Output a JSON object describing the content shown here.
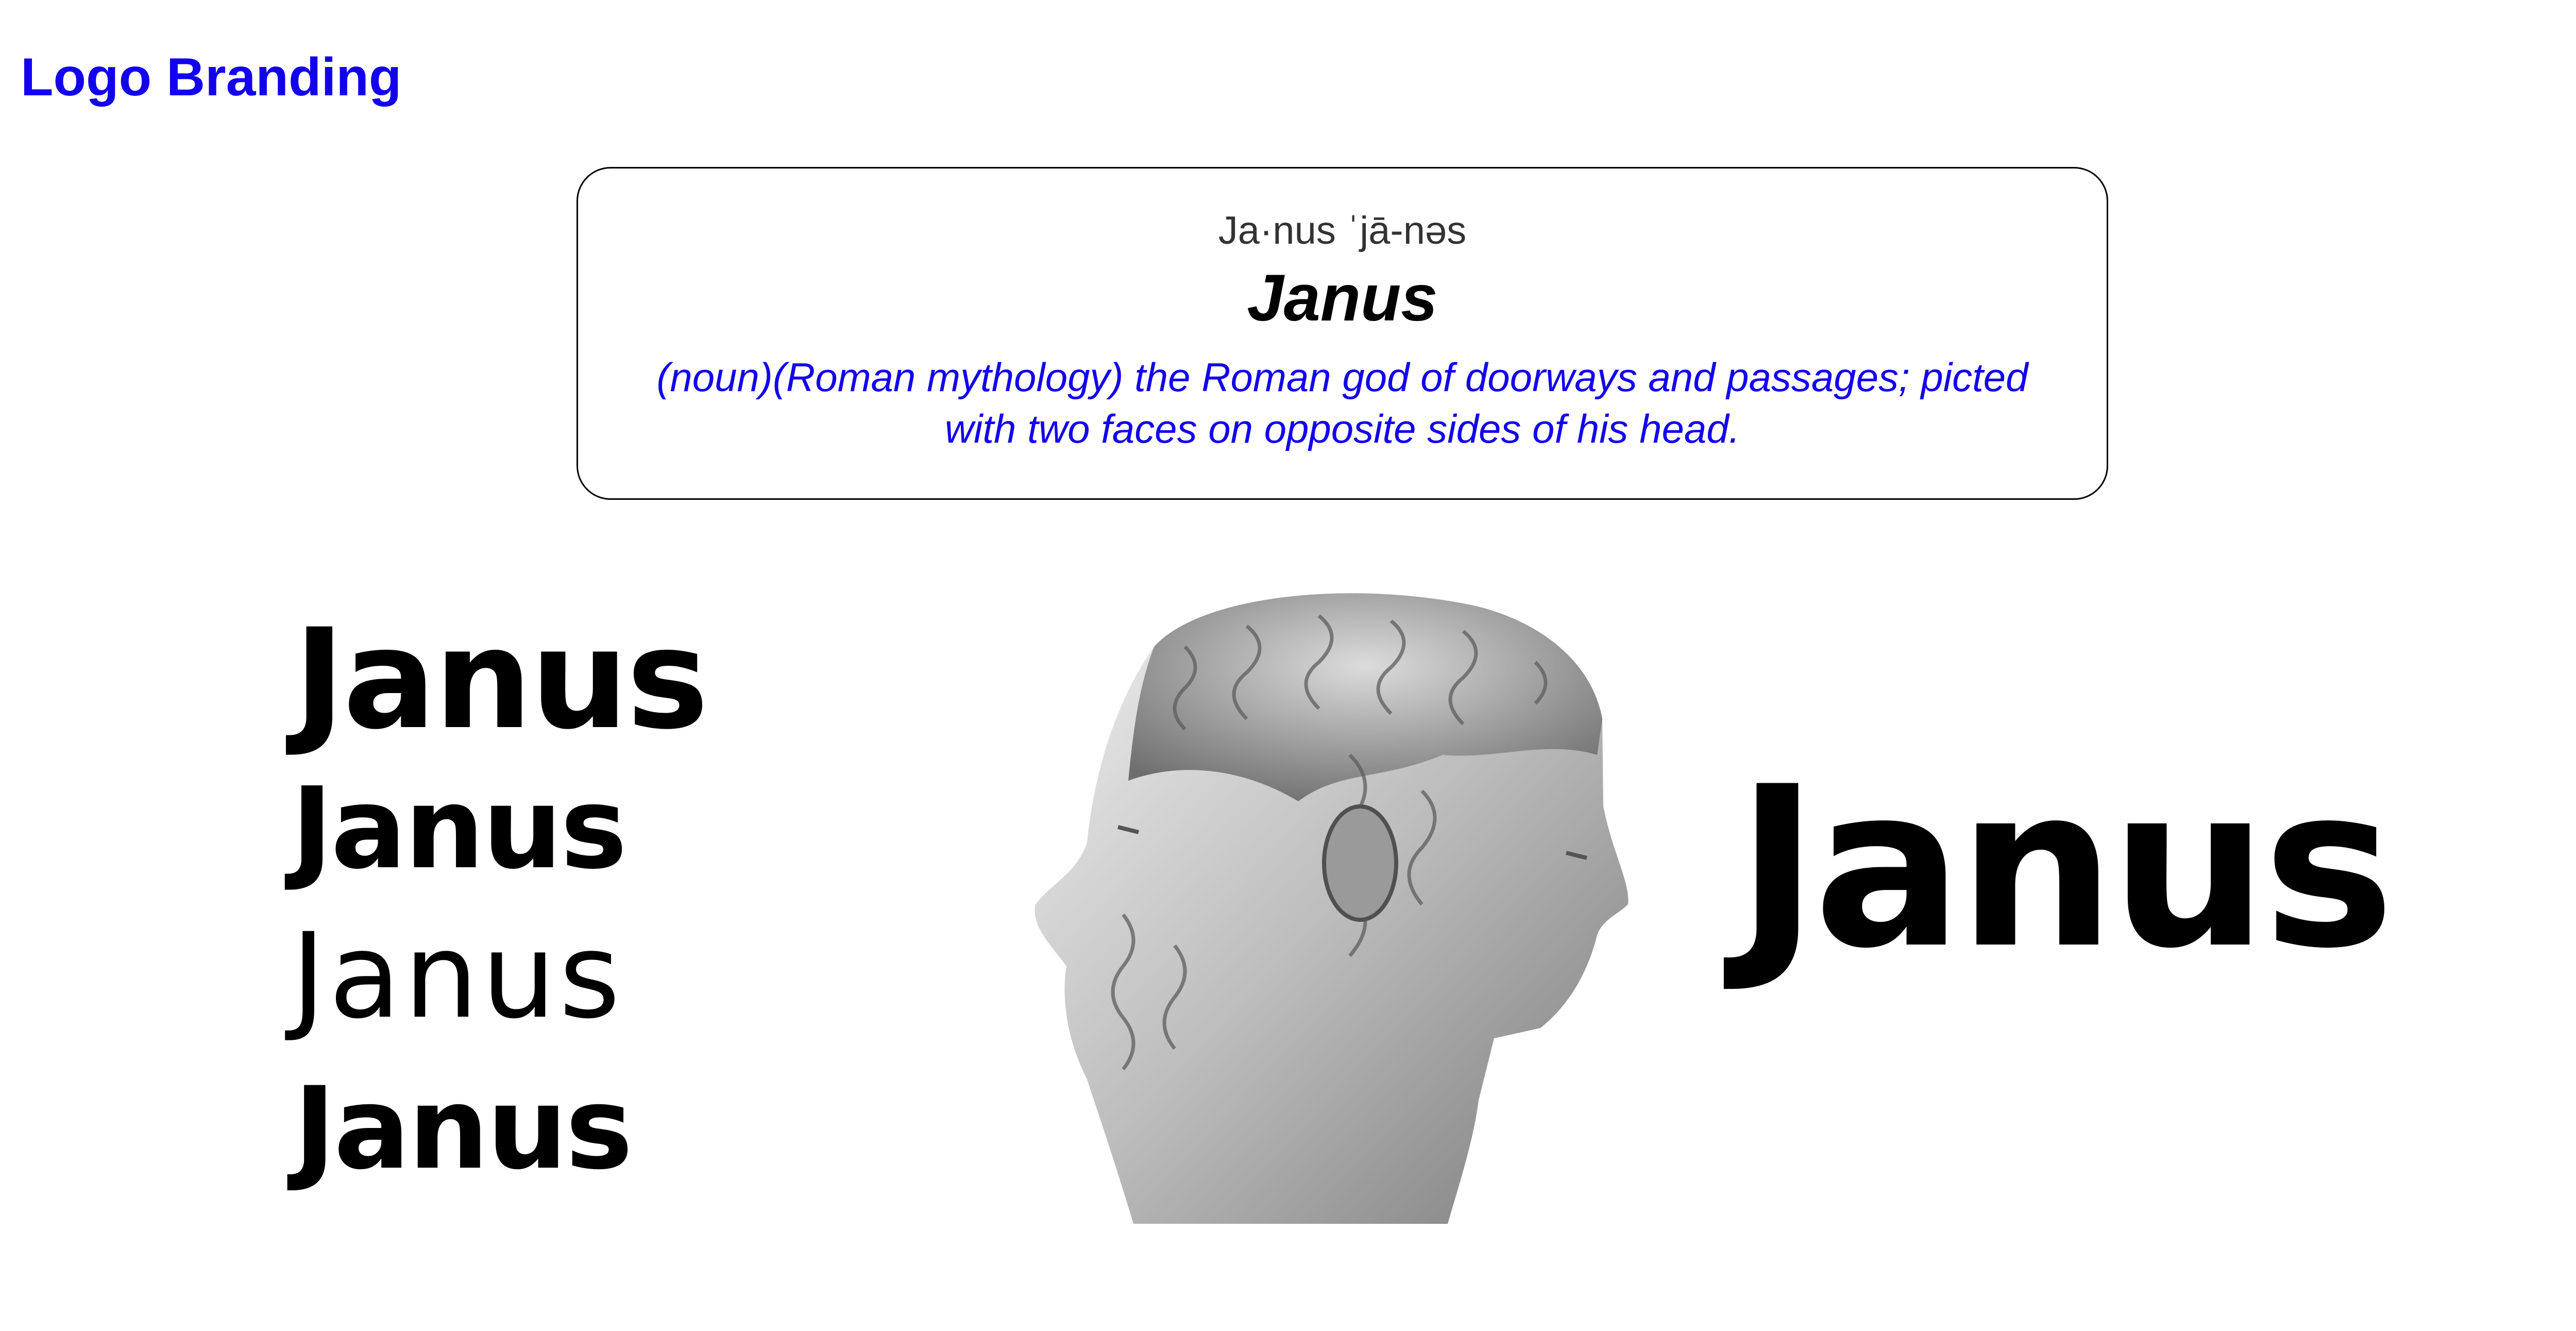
{
  "header": {
    "title": "Logo Branding"
  },
  "definition": {
    "pronunciation": "Ja·nus ˈjā-nəs",
    "word": "Janus",
    "text": "(noun)(Roman mythology) the Roman god of doorways and passages; picted with two faces on opposite sides of his head."
  },
  "logo_variants": [
    {
      "text": "Janus"
    },
    {
      "text": "Janus"
    },
    {
      "text": "Janus"
    },
    {
      "text": "Janus"
    }
  ],
  "primary_logo": {
    "text": "Janus"
  },
  "colors": {
    "accent": "#1200ee",
    "text": "#000000",
    "border": "#000000",
    "background": "#ffffff"
  }
}
